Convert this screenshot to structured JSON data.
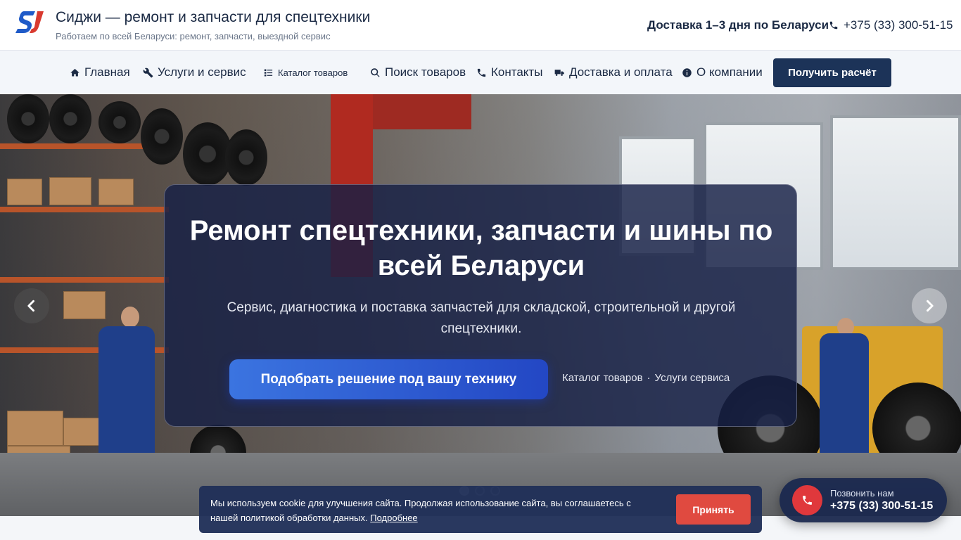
{
  "header": {
    "logo_text": "SJ",
    "title": "Сиджи — ремонт и запчасти для спецтехники",
    "subtitle": "Работаем по всей Беларуси: ремонт, запчасти, выездной сервис",
    "delivery": "Доставка 1–3 дня по Беларуси",
    "phone": "+375 (33) 300-51-15"
  },
  "nav": {
    "items": [
      {
        "label": "Главная",
        "icon": "home-icon"
      },
      {
        "label": "Услуги и сервис",
        "icon": "wrench-icon"
      },
      {
        "label": "Каталог товаров",
        "icon": "list-icon"
      },
      {
        "label": "Поиск товаров",
        "icon": "search-icon"
      },
      {
        "label": "Контакты",
        "icon": "phone-icon"
      },
      {
        "label": "Доставка и оплата",
        "icon": "truck-icon"
      },
      {
        "label": "О компании",
        "icon": "info-icon"
      }
    ],
    "cta": "Получить расчёт"
  },
  "hero": {
    "title": "Ремонт спецтехники, запчасти и шины по всей Беларуси",
    "subtitle": "Сервис, диагностика и поставка запчастей для складской, строительной и другой спецтехники.",
    "button": "Подобрать решение под вашу технику",
    "link_catalog": "Каталог товаров",
    "link_separator": "·",
    "link_services": "Услуги сервиса",
    "slides_total": 3,
    "slide_active": 1
  },
  "cookie": {
    "text": "Мы используем cookie для улучшения сайта. Продолжая использование сайта, вы соглашаетесь с нашей политикой обработки данных.",
    "link": "Подробнее",
    "accept": "Принять"
  },
  "call_widget": {
    "label": "Позвонить нам",
    "phone": "+375 (33) 300-51-15"
  },
  "colors": {
    "primary": "#1c3358",
    "accent_blue": "#2f5fd6",
    "accent_red": "#e0383c"
  }
}
